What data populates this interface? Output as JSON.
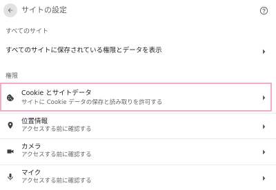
{
  "header": {
    "title": "サイトの設定",
    "back_icon": "arrow-left-icon",
    "help_icon": "help-circle-icon"
  },
  "sections": {
    "all_sites_label": "すべてのサイト",
    "permissions_label": "権限"
  },
  "all_sites_row": {
    "title": "すべてのサイトに保存されている権限とデータを表示"
  },
  "permissions": [
    {
      "icon": "cookie-icon",
      "title": "Cookie とサイトデータ",
      "subtitle": "サイトに Cookie データの保存と読み取りを許可する",
      "highlighted": true
    },
    {
      "icon": "location-pin-icon",
      "title": "位置情報",
      "subtitle": "アクセスする前に確認する"
    },
    {
      "icon": "camera-icon",
      "title": "カメラ",
      "subtitle": "アクセスする前に確認する"
    },
    {
      "icon": "microphone-icon",
      "title": "マイク",
      "subtitle": "アクセスする前に確認する"
    }
  ],
  "colors": {
    "highlight_border": "#f3a9c9",
    "icon": "#5f6368"
  }
}
